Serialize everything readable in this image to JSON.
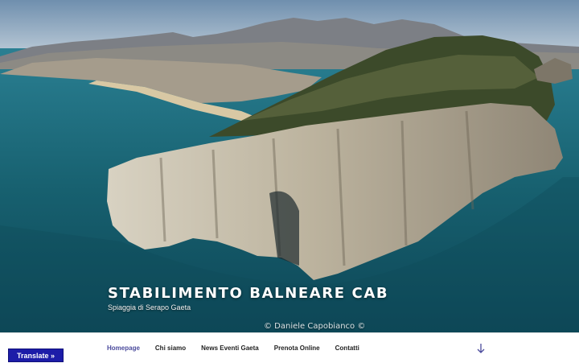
{
  "site": {
    "title": "STABILIMENTO BALNEARE CAB",
    "description": "Spiaggia di Serapo Gaeta",
    "photo_credit": "© Daniele Capobianco ©"
  },
  "nav": {
    "items": [
      {
        "label": "Homepage",
        "active": true
      },
      {
        "label": "Chi siamo",
        "active": false
      },
      {
        "label": "News Eventi Gaeta",
        "active": false
      },
      {
        "label": "Prenota Online",
        "active": false
      },
      {
        "label": "Contatti",
        "active": false
      }
    ],
    "scroll_icon": "arrow-down-icon"
  },
  "translate": {
    "label": "Translate »"
  },
  "colors": {
    "accent": "#4a4a9c",
    "translate_bg": "#1c1ca8",
    "sea": "#165a70",
    "nav_text": "#222222"
  }
}
